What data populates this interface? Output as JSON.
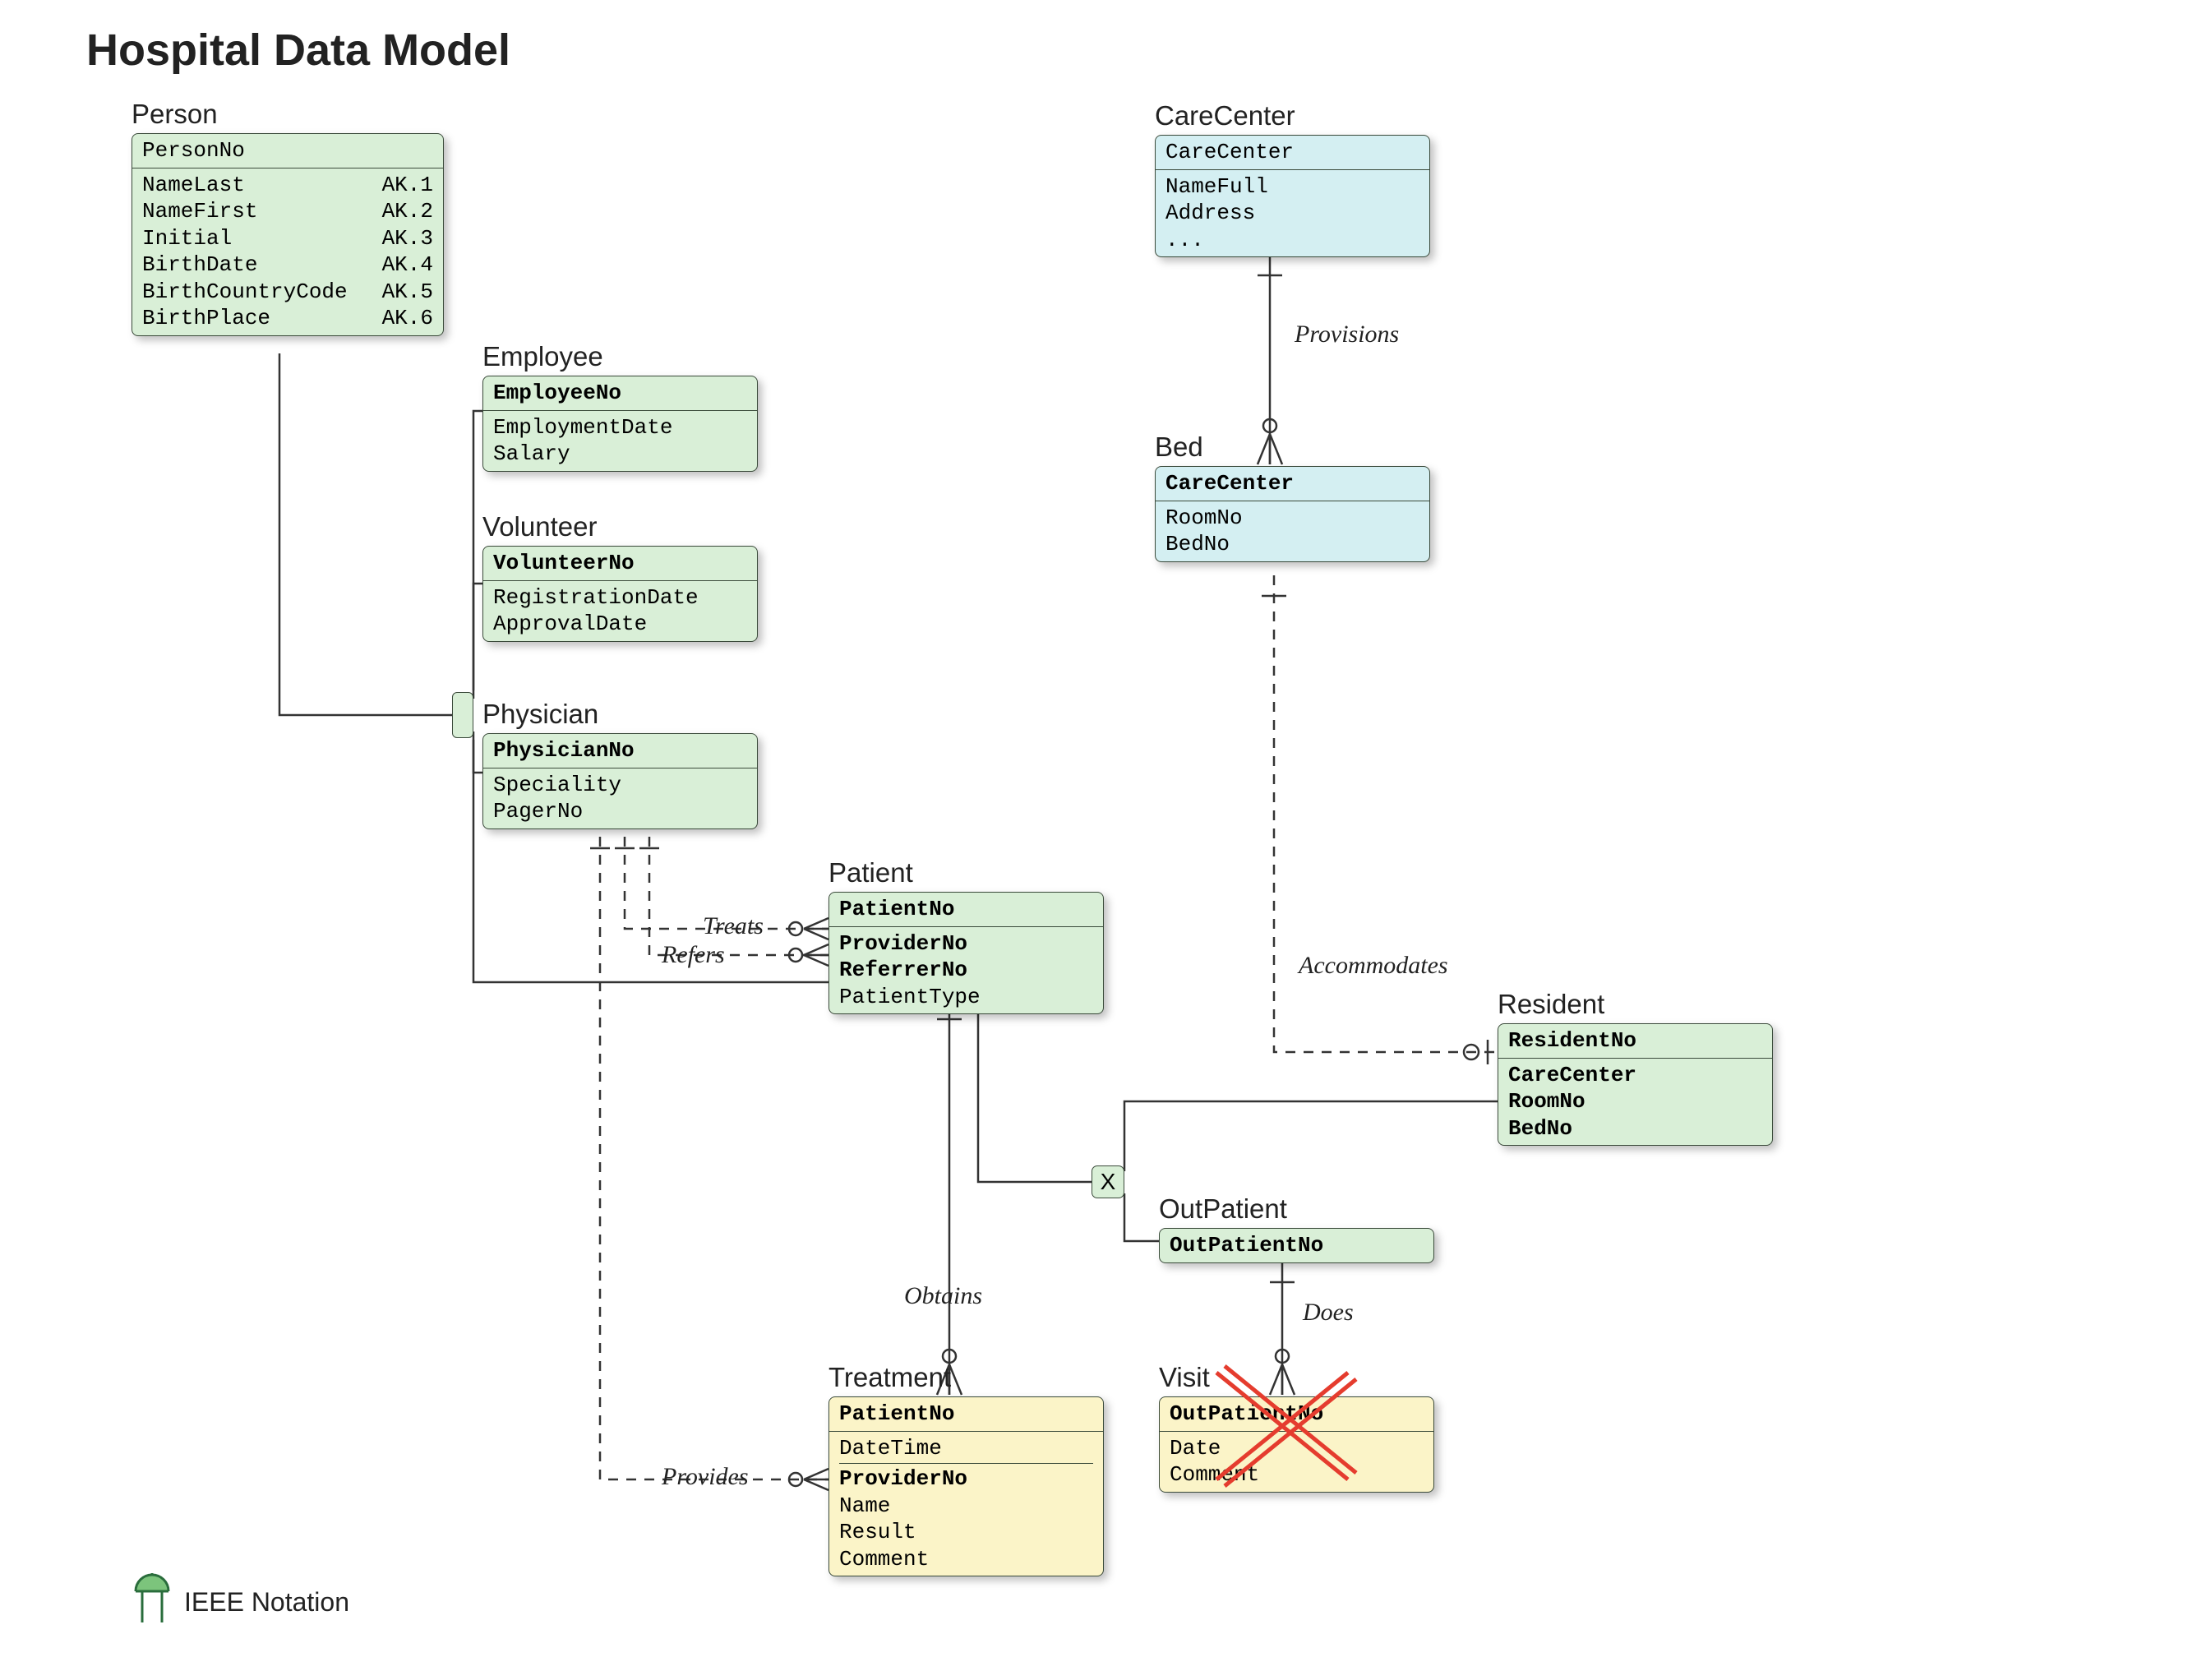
{
  "title": "Hospital Data Model",
  "notation": "IEEE Notation",
  "entities": {
    "person": {
      "label": "Person",
      "header": "PersonNo",
      "attrs": [
        {
          "name": "NameLast",
          "ak": "AK.1"
        },
        {
          "name": "NameFirst",
          "ak": "AK.2"
        },
        {
          "name": "Initial",
          "ak": "AK.3"
        },
        {
          "name": "BirthDate",
          "ak": "AK.4"
        },
        {
          "name": "BirthCountryCode",
          "ak": "AK.5"
        },
        {
          "name": "BirthPlace",
          "ak": "AK.6"
        }
      ]
    },
    "employee": {
      "label": "Employee",
      "header": "EmployeeNo",
      "attrs": [
        {
          "name": "EmploymentDate"
        },
        {
          "name": "Salary"
        }
      ]
    },
    "volunteer": {
      "label": "Volunteer",
      "header": "VolunteerNo",
      "attrs": [
        {
          "name": "RegistrationDate"
        },
        {
          "name": "ApprovalDate"
        }
      ]
    },
    "physician": {
      "label": "Physician",
      "header": "PhysicianNo",
      "attrs": [
        {
          "name": "Speciality"
        },
        {
          "name": "PagerNo"
        }
      ]
    },
    "patient": {
      "label": "Patient",
      "header": "PatientNo",
      "attrs": [
        {
          "name": "ProviderNo",
          "bold": true
        },
        {
          "name": "ReferrerNo",
          "bold": true
        },
        {
          "name": "PatientType"
        }
      ]
    },
    "carecenter": {
      "label": "CareCenter",
      "header": "CareCenter",
      "attrs": [
        {
          "name": "NameFull"
        },
        {
          "name": "Address"
        },
        {
          "name": "..."
        }
      ]
    },
    "bed": {
      "label": "Bed",
      "header": "CareCenter",
      "attrs": [
        {
          "name": "RoomNo"
        },
        {
          "name": "BedNo"
        }
      ]
    },
    "resident": {
      "label": "Resident",
      "header": "ResidentNo",
      "attrs": [
        {
          "name": "CareCenter",
          "bold": true
        },
        {
          "name": "RoomNo",
          "bold": true
        },
        {
          "name": "BedNo",
          "bold": true
        }
      ]
    },
    "outpatient": {
      "label": "OutPatient",
      "header": "OutPatientNo",
      "attrs": []
    },
    "treatment": {
      "label": "Treatment",
      "header": "PatientNo",
      "attrs": [
        {
          "name": "DateTime"
        },
        {
          "name": "ProviderNo",
          "bold": true,
          "sep": true
        },
        {
          "name": "Name"
        },
        {
          "name": "Result"
        },
        {
          "name": "Comment"
        }
      ]
    },
    "visit": {
      "label": "Visit",
      "header": "OutPatientNo",
      "attrs": [
        {
          "name": "Date"
        },
        {
          "name": "Comment"
        }
      ]
    }
  },
  "relations": {
    "provisions": "Provisions",
    "treats": "Treats",
    "refers": "Refers",
    "accommodates": "Accommodates",
    "obtains": "Obtains",
    "does": "Does",
    "provides": "Provides"
  },
  "junction_x": "X"
}
